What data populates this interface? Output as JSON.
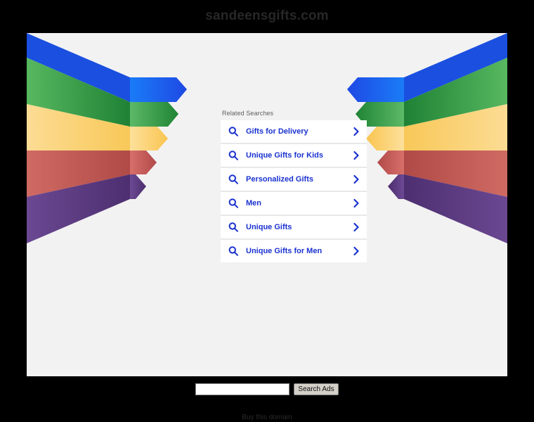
{
  "page": {
    "domain_title": "sandeensgifts.com",
    "background_color": "#000000",
    "panel_color": "#f2f2f2"
  },
  "related": {
    "heading": "Related Searches",
    "accent_color": "#1a32d0",
    "items": [
      {
        "label": "Gifts for Delivery",
        "search_icon": "search-icon",
        "chevron_icon": "chevron-right-icon"
      },
      {
        "label": "Unique Gifts for Kids",
        "search_icon": "search-icon",
        "chevron_icon": "chevron-right-icon"
      },
      {
        "label": "Personalized Gifts",
        "search_icon": "search-icon",
        "chevron_icon": "chevron-right-icon"
      },
      {
        "label": "Men",
        "search_icon": "search-icon",
        "chevron_icon": "chevron-right-icon"
      },
      {
        "label": "Unique Gifts",
        "search_icon": "search-icon",
        "chevron_icon": "chevron-right-icon"
      },
      {
        "label": "Unique Gifts for Men",
        "search_icon": "search-icon",
        "chevron_icon": "chevron-right-icon"
      }
    ]
  },
  "search_form": {
    "input_value": "",
    "input_placeholder": "",
    "button_label": "Search Ads"
  },
  "footer": {
    "buy_link_label": "Buy this domain"
  },
  "artwork": {
    "name": "chevron-bands-graphic",
    "bands": [
      {
        "name": "blue",
        "color": "#1a6ff0",
        "shade": "#1550c8",
        "back": "#1f63ee"
      },
      {
        "name": "green",
        "color": "#4aaf52",
        "shade": "#238a3a",
        "back": "#4db162"
      },
      {
        "name": "yellow",
        "color": "#fbd06c",
        "shade": "#f7c35a",
        "back": "#fcd87f"
      },
      {
        "name": "red",
        "color": "#d4605c",
        "shade": "#b94a47",
        "back": "#c25b57"
      },
      {
        "name": "purple",
        "color": "#5d3b86",
        "shade": "#4a2e6b",
        "back": "#6a4490"
      }
    ]
  }
}
